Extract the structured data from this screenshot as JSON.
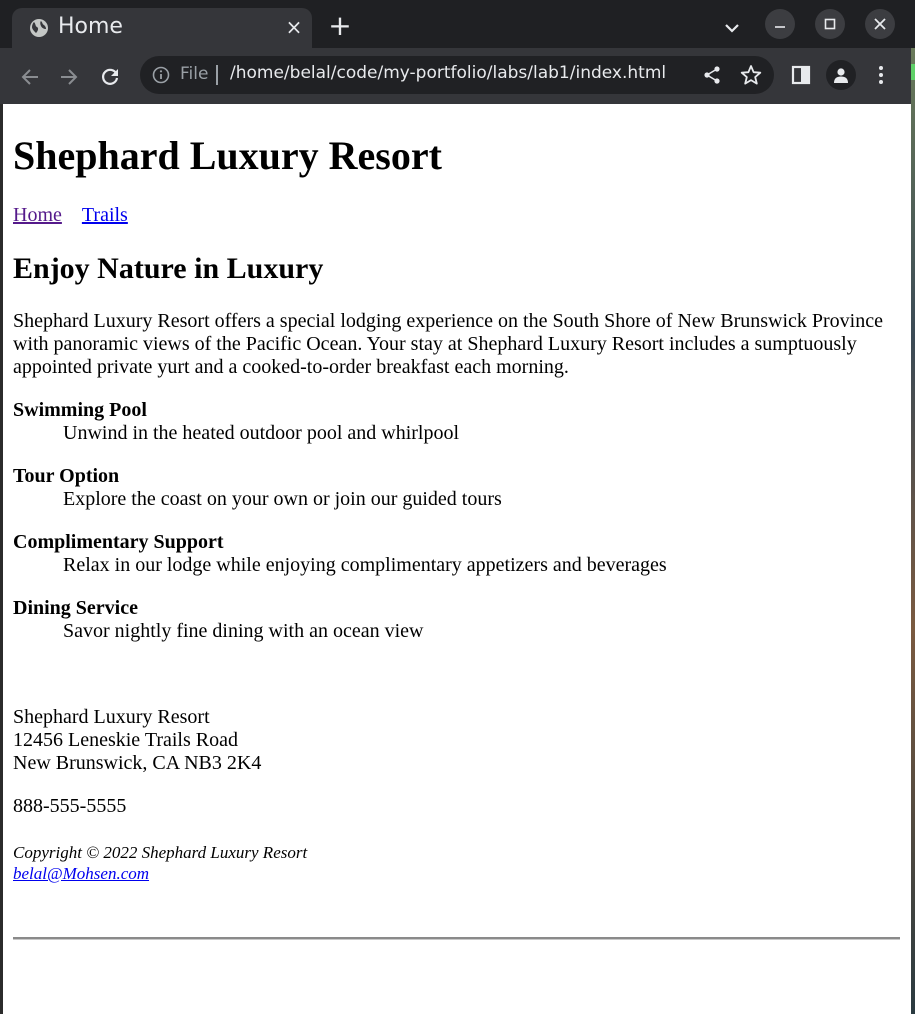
{
  "browser": {
    "tab_title": "Home",
    "tab_close_glyph": "×",
    "new_tab_glyph": "+",
    "scheme_label": "File",
    "url": "/home/belal/code/my-portfolio/labs/lab1/index.html",
    "icons": [
      "globe-icon",
      "close-icon",
      "plus-icon",
      "chevron-down-icon",
      "minimize-icon",
      "maximize-icon",
      "close-window-icon",
      "back-arrow-icon",
      "forward-arrow-icon",
      "reload-icon",
      "info-icon",
      "share-icon",
      "star-icon",
      "side-panel-icon",
      "profile-icon",
      "kebab-menu-icon"
    ],
    "colors": {
      "tabstrip": "#1f2023",
      "toolbar": "#35363a",
      "omnibox": "#202124",
      "text": "#e8eaed"
    }
  },
  "page": {
    "title": "Shephard Luxury Resort",
    "nav": [
      {
        "label": "Home"
      },
      {
        "label": "Trails"
      }
    ],
    "heading": "Enjoy Nature in Luxury",
    "intro": "Shephard Luxury Resort offers a special lodging experience on the South Shore of New Brunswick Province with panoramic views of the Pacific Ocean. Your stay at Shephard Luxury Resort includes a sumptuously appointed private yurt and a cooked-to-order breakfast each morning.",
    "amenities": [
      {
        "term": "Swimming Pool",
        "desc": "Unwind in the heated outdoor pool and whirlpool"
      },
      {
        "term": "Tour Option",
        "desc": "Explore the coast on your own or join our guided tours"
      },
      {
        "term": "Complimentary Support",
        "desc": "Relax in our lodge while enjoying complimentary appetizers and beverages"
      },
      {
        "term": "Dining Service",
        "desc": "Savor nightly fine dining with an ocean view"
      }
    ],
    "address": {
      "name": "Shephard Luxury Resort",
      "street": "12456 Leneskie Trails Road",
      "city": "New Brunswick, CA NB3 2K4"
    },
    "phone": "888-555-5555",
    "copyright": "Copyright © 2022 Shephard Luxury Resort",
    "email": "belal@Mohsen.com"
  }
}
